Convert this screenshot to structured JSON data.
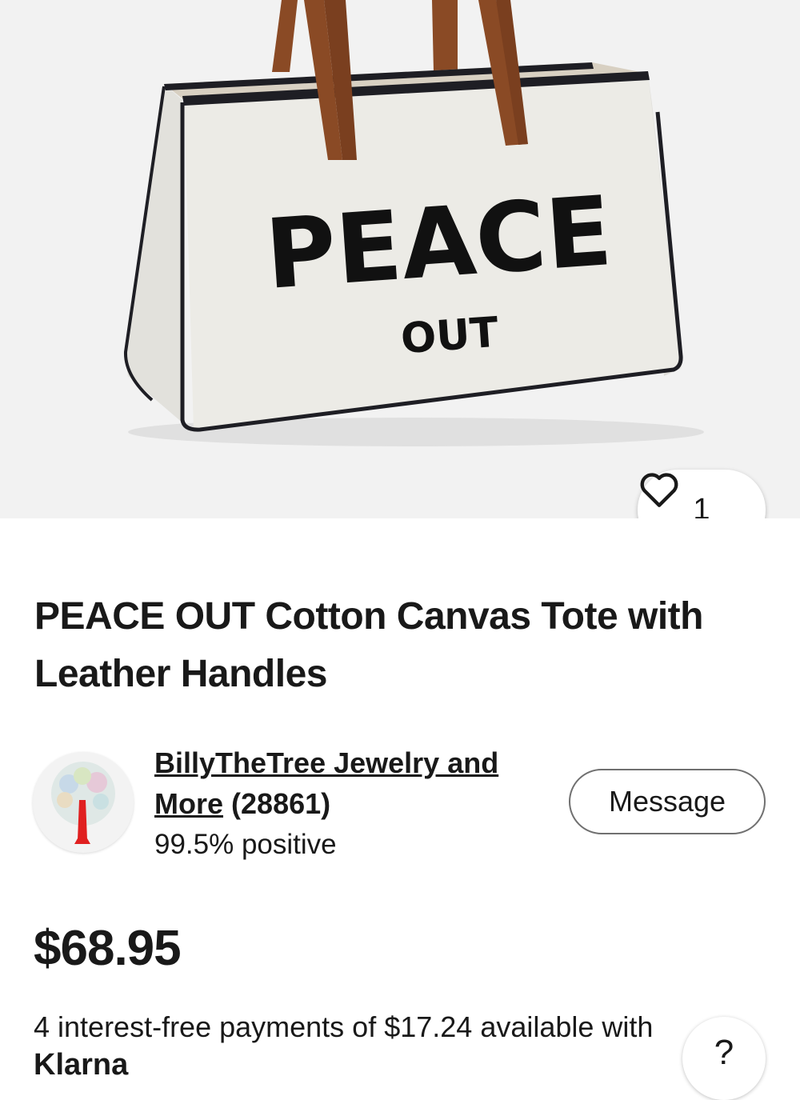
{
  "hero": {
    "bag_text_main": "PEACE",
    "bag_text_sub": "OUT",
    "watch_count": "1"
  },
  "product": {
    "title": "PEACE OUT Cotton Canvas Tote with Leather Handles"
  },
  "seller": {
    "name": "BillyTheTree Jewelry and More",
    "feedback_count": "(28861)",
    "positive": "99.5% positive",
    "message_label": "Message"
  },
  "price": {
    "amount": "$68.95",
    "installments_text": "4 interest-free payments of $17.24 available with",
    "provider": "Klarna",
    "help_label": "?"
  },
  "colors": {
    "hero_bg": "#f2f2f2",
    "text": "#191919",
    "handle": "#8a4a25",
    "canvas": "#ecebe6"
  }
}
